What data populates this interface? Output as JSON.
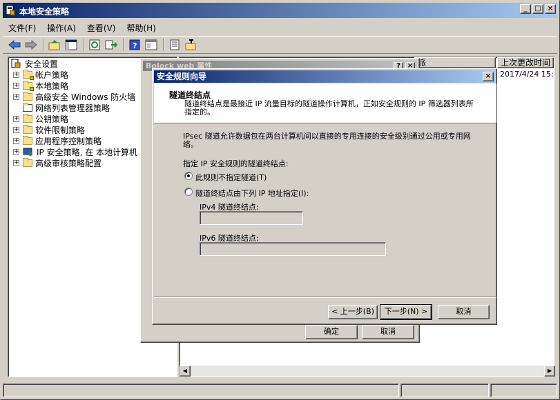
{
  "window": {
    "title": "本地安全策略",
    "controls": [
      "_",
      "□",
      "×"
    ]
  },
  "menu": [
    "文件(F)",
    "操作(A)",
    "查看(V)",
    "帮助(H)"
  ],
  "toolbar_icons": [
    "back-arrow-icon",
    "forward-arrow-icon",
    "up-folder-icon",
    "show-hide-tree-icon",
    "refresh-icon",
    "export-list-icon",
    "help-icon",
    "console-icon",
    "properties-icon",
    "import-export-icon"
  ],
  "tree": {
    "root": "安全设置",
    "items": [
      {
        "label": "帐户策略",
        "expandable": true
      },
      {
        "label": "本地策略",
        "expandable": true
      },
      {
        "label": "高级安全 Windows 防火墙",
        "expandable": true
      },
      {
        "label": "网络列表管理器策略",
        "expandable": false
      },
      {
        "label": "公钥策略",
        "expandable": true
      },
      {
        "label": "软件限制策略",
        "expandable": true
      },
      {
        "label": "应用程序控制策略",
        "expandable": true
      },
      {
        "label": "IP 安全策略, 在 本地计算机",
        "expandable": true
      },
      {
        "label": "高级审核策略配置",
        "expandable": true
      }
    ]
  },
  "list": {
    "columns": [
      "派",
      "上次更改时间"
    ],
    "rows": [
      {
        "modified": "2017/4/24 15:"
      }
    ]
  },
  "props_dialog": {
    "title": "Bolock web 属性",
    "ok_label": "确定",
    "cancel_label": "取消"
  },
  "wizard": {
    "title": "安全规则向导",
    "close_label": "×",
    "header_title": "隧道终结点",
    "header_desc": "隧道终结点是最接近 IP 流量目标的隧道操作计算机，正如安全规则的 IP 筛选器列表所指定的。",
    "body_desc": "IPsec 隧道允许数据包在两台计算机间以直接的专用连接的安全级别通过公用或专用网络。",
    "group_label": "指定 IP 安全规则的隧道终结点:",
    "option_no_tunnel": "此规则不指定隧道(T)",
    "option_ip_tunnel": "隧道终结点由下列 IP 地址指定(I):",
    "ipv4_label": "IPv4 隧道终结点:",
    "ipv4_value": "",
    "ipv6_label": "IPv6 隧道终结点:",
    "ipv6_value": "",
    "back_label": "< 上一步(B)",
    "next_label": "下一步(N) >",
    "cancel_label": "取消"
  }
}
